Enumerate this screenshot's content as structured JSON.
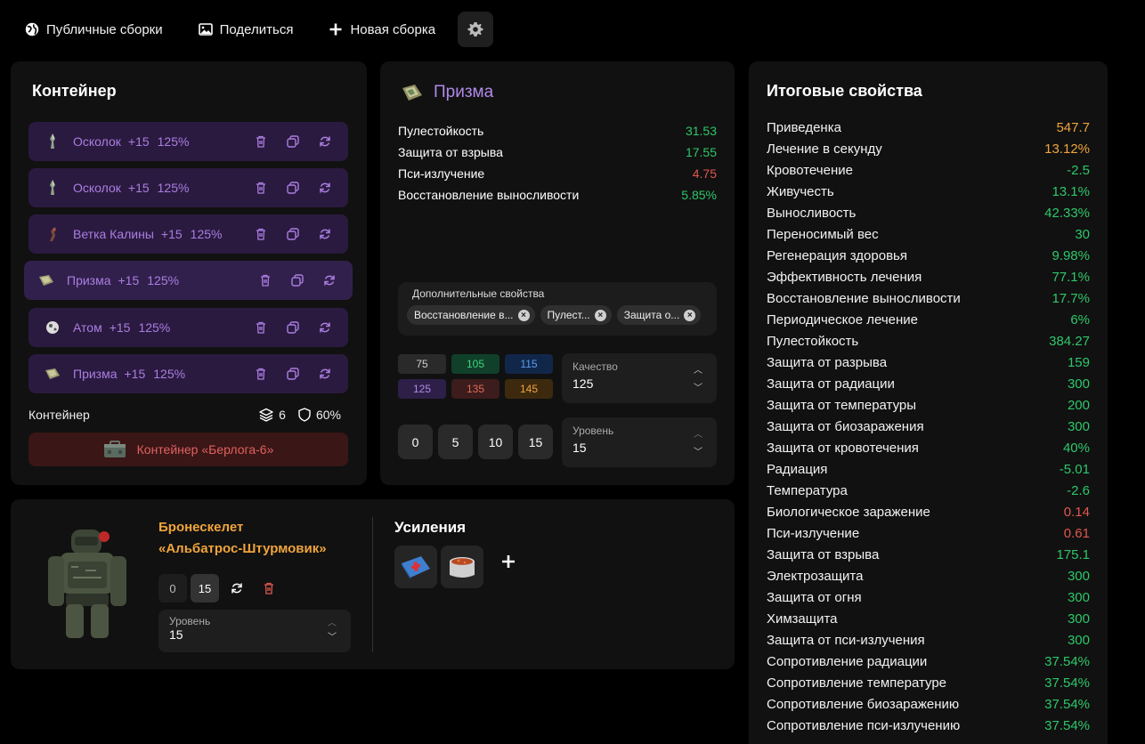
{
  "toolbar": {
    "public_label": "Публичные сборки",
    "share_label": "Поделиться",
    "new_label": "Новая сборка"
  },
  "container": {
    "title": "Контейнер",
    "slots": [
      {
        "name": "Осколок",
        "upgrade": "+15",
        "quality": "125%"
      },
      {
        "name": "Осколок",
        "upgrade": "+15",
        "quality": "125%"
      },
      {
        "name": "Ветка Калины",
        "upgrade": "+15",
        "quality": "125%"
      },
      {
        "name": "Призма",
        "upgrade": "+15",
        "quality": "125%"
      },
      {
        "name": "Атом",
        "upgrade": "+15",
        "quality": "125%"
      },
      {
        "name": "Призма",
        "upgrade": "+15",
        "quality": "125%"
      }
    ],
    "footer_label": "Контейнер",
    "slots_count": "6",
    "protection": "60%",
    "container_button": "Контейнер «Берлога-6»"
  },
  "artifact": {
    "title": "Призма",
    "stats": [
      {
        "name": "Пулестойкость",
        "value": "31.53",
        "color": "#2ec76a"
      },
      {
        "name": "Защита от взрыва",
        "value": "17.55",
        "color": "#2ec76a"
      },
      {
        "name": "Пси-излучение",
        "value": "4.75",
        "color": "#e0574f"
      },
      {
        "name": "Восстановление выносливости",
        "value": "5.85%",
        "color": "#2ec76a"
      }
    ],
    "additional_label": "Дополнительные свойства",
    "chips": [
      "Восстановление в...",
      "Пулест...",
      "Защита о..."
    ],
    "quality_presets": [
      {
        "value": "75",
        "bg": "#2a2a2a",
        "fg": "#cfcfcf"
      },
      {
        "value": "105",
        "bg": "#10402a",
        "fg": "#3fd37d"
      },
      {
        "value": "115",
        "bg": "#11274a",
        "fg": "#5a9cf0"
      },
      {
        "value": "125",
        "bg": "#2e1f48",
        "fg": "#b08ae8"
      },
      {
        "value": "135",
        "bg": "#3c1c1c",
        "fg": "#e06a5a"
      },
      {
        "value": "145",
        "bg": "#3d2a0e",
        "fg": "#f0a43c"
      }
    ],
    "quality_label": "Качество",
    "quality_value": "125",
    "level_presets": [
      "0",
      "5",
      "10",
      "15"
    ],
    "level_label": "Уровень",
    "level_value": "15"
  },
  "totals": {
    "title": "Итоговые свойства",
    "rows": [
      {
        "name": "Приведенка",
        "value": "547.7",
        "color": "#f0a43c"
      },
      {
        "name": "Лечение в секунду",
        "value": "13.12%",
        "color": "#f0a43c"
      },
      {
        "name": "Кровотечение",
        "value": "-2.5",
        "color": "#2ec76a"
      },
      {
        "name": "Живучесть",
        "value": "13.1%",
        "color": "#2ec76a"
      },
      {
        "name": "Выносливость",
        "value": "42.33%",
        "color": "#2ec76a"
      },
      {
        "name": "Переносимый вес",
        "value": "30",
        "color": "#2ec76a"
      },
      {
        "name": "Регенерация здоровья",
        "value": "9.98%",
        "color": "#2ec76a"
      },
      {
        "name": "Эффективность лечения",
        "value": "77.1%",
        "color": "#2ec76a"
      },
      {
        "name": "Восстановление выносливости",
        "value": "17.7%",
        "color": "#2ec76a"
      },
      {
        "name": "Периодическое лечение",
        "value": "6%",
        "color": "#2ec76a"
      },
      {
        "name": "Пулестойкость",
        "value": "384.27",
        "color": "#2ec76a"
      },
      {
        "name": "Защита от разрыва",
        "value": "159",
        "color": "#2ec76a"
      },
      {
        "name": "Защита от радиации",
        "value": "300",
        "color": "#2ec76a"
      },
      {
        "name": "Защита от температуры",
        "value": "200",
        "color": "#2ec76a"
      },
      {
        "name": "Защита от биозаражения",
        "value": "300",
        "color": "#2ec76a"
      },
      {
        "name": "Защита от кровотечения",
        "value": "40%",
        "color": "#2ec76a"
      },
      {
        "name": "Радиация",
        "value": "-5.01",
        "color": "#2ec76a"
      },
      {
        "name": "Температура",
        "value": "-2.6",
        "color": "#2ec76a"
      },
      {
        "name": "Биологическое заражение",
        "value": "0.14",
        "color": "#e0574f"
      },
      {
        "name": "Пси-излучение",
        "value": "0.61",
        "color": "#e0574f"
      },
      {
        "name": "Защита от взрыва",
        "value": "175.1",
        "color": "#2ec76a"
      },
      {
        "name": "Электрозащита",
        "value": "300",
        "color": "#2ec76a"
      },
      {
        "name": "Защита от огня",
        "value": "300",
        "color": "#2ec76a"
      },
      {
        "name": "Химзащита",
        "value": "300",
        "color": "#2ec76a"
      },
      {
        "name": "Защита от пси-излучения",
        "value": "300",
        "color": "#2ec76a"
      },
      {
        "name": "Сопротивление радиации",
        "value": "37.54%",
        "color": "#2ec76a"
      },
      {
        "name": "Сопротивление температуре",
        "value": "37.54%",
        "color": "#2ec76a"
      },
      {
        "name": "Сопротивление биозаражению",
        "value": "37.54%",
        "color": "#2ec76a"
      },
      {
        "name": "Сопротивление пси-излучению",
        "value": "37.54%",
        "color": "#2ec76a"
      }
    ]
  },
  "armor": {
    "name_line1": "Бронескелет",
    "name_line2": "«Альбатрос-Штурмовик»",
    "upgrade_min": "0",
    "upgrade_max": "15",
    "level_label": "Уровень",
    "level_value": "15",
    "boosts_title": "Усиления",
    "boosts": [
      "medkit-icon",
      "stew-pot-icon"
    ],
    "add_label": "+"
  }
}
